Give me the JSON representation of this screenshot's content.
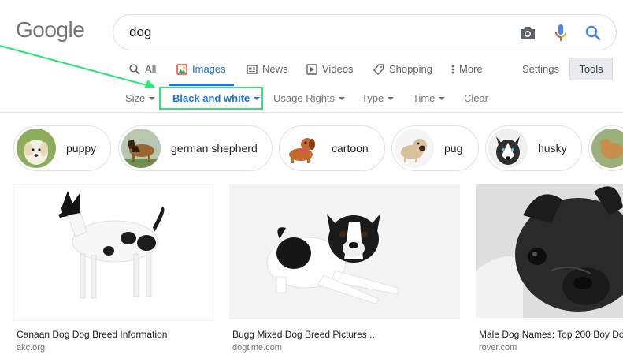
{
  "logo": "Google",
  "search": {
    "query": "dog"
  },
  "tabs": [
    {
      "label": "All",
      "icon": "search-icon"
    },
    {
      "label": "Images",
      "icon": "images-icon",
      "active": true
    },
    {
      "label": "News",
      "icon": "news-icon"
    },
    {
      "label": "Videos",
      "icon": "videos-icon"
    },
    {
      "label": "Shopping",
      "icon": "shopping-tag-icon"
    },
    {
      "label": "More",
      "icon": "more-dots-icon"
    }
  ],
  "settings_label": "Settings",
  "tools_label": "Tools",
  "filters": {
    "size": "Size",
    "color": "Black and white",
    "usage_rights": "Usage Rights",
    "type": "Type",
    "time": "Time",
    "clear": "Clear"
  },
  "chips": [
    {
      "label": "puppy"
    },
    {
      "label": "german shepherd"
    },
    {
      "label": "cartoon"
    },
    {
      "label": "pug"
    },
    {
      "label": "husky"
    }
  ],
  "results": [
    {
      "title": "Canaan Dog Dog Breed Information",
      "source": "akc.org"
    },
    {
      "title": "Bugg Mixed Dog Breed Pictures ...",
      "source": "dogtime.com"
    },
    {
      "title": "Male Dog Names: Top 200 Boy Do",
      "source": "rover.com"
    }
  ],
  "colors": {
    "accent_blue": "#1a73e8",
    "annotation_green": "#2ee57a",
    "muted_text": "#5f6368"
  }
}
